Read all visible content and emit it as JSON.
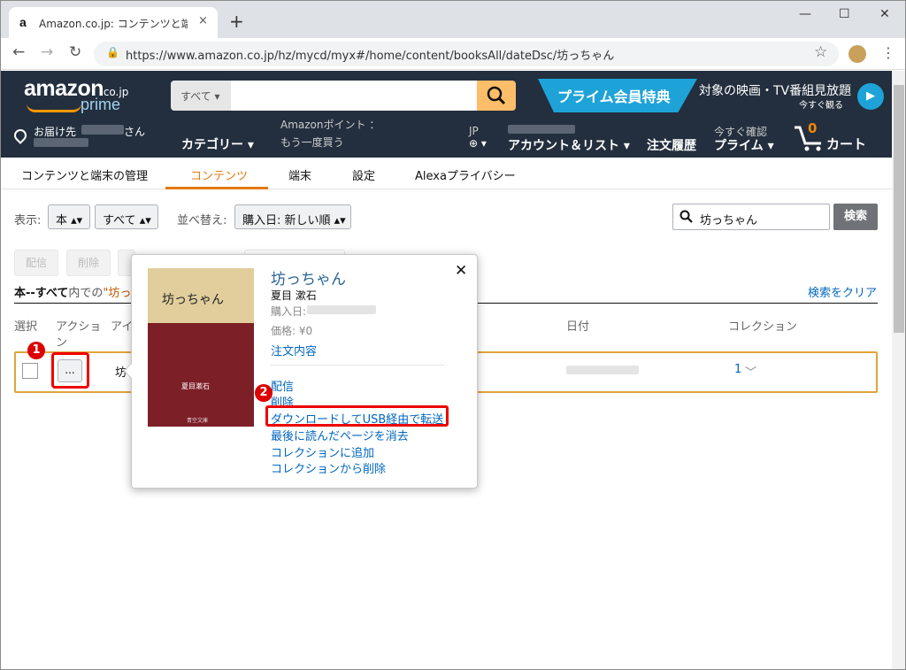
{
  "browser": {
    "tab_title": "Amazon.co.jp: コンテンツと端末の管",
    "tab_favicon": "a",
    "tab_close": "×",
    "new_tab": "+",
    "minimize": "—",
    "maximize": "☐",
    "close": "✕",
    "back": "←",
    "forward": "→",
    "reload": "↻",
    "lock": "🔒",
    "url": "https://www.amazon.co.jp/hz/mycd/myx#/home/content/booksAll/dateDsc/坊っちゃん",
    "bookmark": "☆",
    "menu": "⋮"
  },
  "header": {
    "logo_text": "amazon",
    "logo_suffix": ".co.jp",
    "logo_prime": "prime",
    "search_category": "すべて ▾",
    "search_icon": "magnifier-icon",
    "prime_banner": "プライム会員特典",
    "video_text": "対象の映画・TV番組見放題",
    "video_sub": "今すぐ観る",
    "play_icon": "▶",
    "deliver_to": "お届け先",
    "deliver_san": "さん",
    "categories": "カテゴリー ▾",
    "points_label": "Amazonポイント ：",
    "buy_again": "もう一度買う",
    "lang": "JP",
    "lang_globe": "⊕ ▾",
    "account": "アカウント＆リスト ▾",
    "orders": "注文履歴",
    "prime_try": "今すぐ確認",
    "prime": "プライム ▾",
    "cart_count": "0",
    "cart": "カート"
  },
  "subnav": {
    "title": "コンテンツと端末の管理",
    "tabs": [
      "コンテンツ",
      "端末",
      "設定",
      "Alexaプライバシー"
    ]
  },
  "filters": {
    "display_label": "表示:",
    "type": "本 ▴▾",
    "scope": "すべて ▴▾",
    "sort_label": "並べ替え:",
    "sort": "購入日: 新しい順 ▴▾",
    "search_value": "坊っちゃん",
    "search_button": "検索"
  },
  "actions": {
    "deliver": "配信",
    "delete": "削除"
  },
  "results": {
    "summary_bold": "本--すべて",
    "summary_mid": "内での",
    "summary_query": "\"坊っち",
    "clear_search": "検索をクリア"
  },
  "columns": {
    "select": "選択",
    "action_1": "アクショ",
    "action_2": "ン",
    "item": "アイ",
    "date": "日付",
    "collection": "コレクション"
  },
  "row": {
    "dots": "...",
    "title_fragment": "坊",
    "collection_count": "1",
    "chevron": "﹀"
  },
  "markers": {
    "one": "1",
    "two": "2"
  },
  "popover": {
    "cover_title": "坊っちゃん",
    "cover_author": "夏目漱石",
    "cover_publisher": "青空文庫",
    "title": "坊っちゃん",
    "close": "✕",
    "author": "夏目 漱石",
    "purchase_date_label": "購入日:",
    "price": "価格: ¥0",
    "order_details": "注文内容",
    "menu": [
      "配信",
      "削除",
      "ダウンロードしてUSB経由で転送",
      "最後に読んだページを消去",
      "コレクションに追加",
      "コレクションから削除"
    ]
  }
}
